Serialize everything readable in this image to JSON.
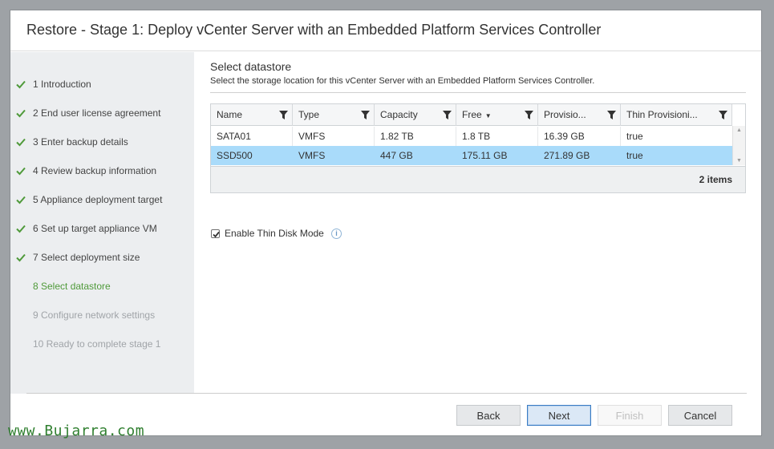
{
  "dialog": {
    "title": "Restore - Stage 1: Deploy vCenter Server with an Embedded Platform Services Controller"
  },
  "steps": [
    {
      "label": "1 Introduction",
      "state": "done"
    },
    {
      "label": "2 End user license agreement",
      "state": "done"
    },
    {
      "label": "3 Enter backup details",
      "state": "done"
    },
    {
      "label": "4 Review backup information",
      "state": "done"
    },
    {
      "label": "5 Appliance deployment target",
      "state": "done"
    },
    {
      "label": "6 Set up target appliance VM",
      "state": "done"
    },
    {
      "label": "7 Select deployment size",
      "state": "done"
    },
    {
      "label": "8 Select datastore",
      "state": "current"
    },
    {
      "label": "9 Configure network settings",
      "state": "todo"
    },
    {
      "label": "10 Ready to complete stage 1",
      "state": "todo"
    }
  ],
  "section": {
    "title": "Select datastore",
    "description": "Select the storage location for this vCenter Server with an Embedded Platform Services Controller."
  },
  "grid": {
    "columns": [
      "Name",
      "Type",
      "Capacity",
      "Free",
      "Provisio...",
      "Thin Provisioni..."
    ],
    "sort_indicator": "▼",
    "rows": [
      {
        "cells": [
          "SATA01",
          "VMFS",
          "1.82 TB",
          "1.8 TB",
          "16.39 GB",
          "true"
        ],
        "selected": false
      },
      {
        "cells": [
          "SSD500",
          "VMFS",
          "447 GB",
          "175.11 GB",
          "271.89 GB",
          "true"
        ],
        "selected": true
      }
    ],
    "item_count": "2 items"
  },
  "thin_disk": {
    "label": "Enable Thin Disk Mode",
    "checked": true,
    "info_glyph": "i"
  },
  "buttons": {
    "back": "Back",
    "next": "Next",
    "finish": "Finish",
    "cancel": "Cancel"
  },
  "watermark": "www.Bujarra.com",
  "colors": {
    "check_green": "#4f9a3a",
    "selected_row": "#a9dbfa",
    "primary_border": "#3b7dc4"
  }
}
